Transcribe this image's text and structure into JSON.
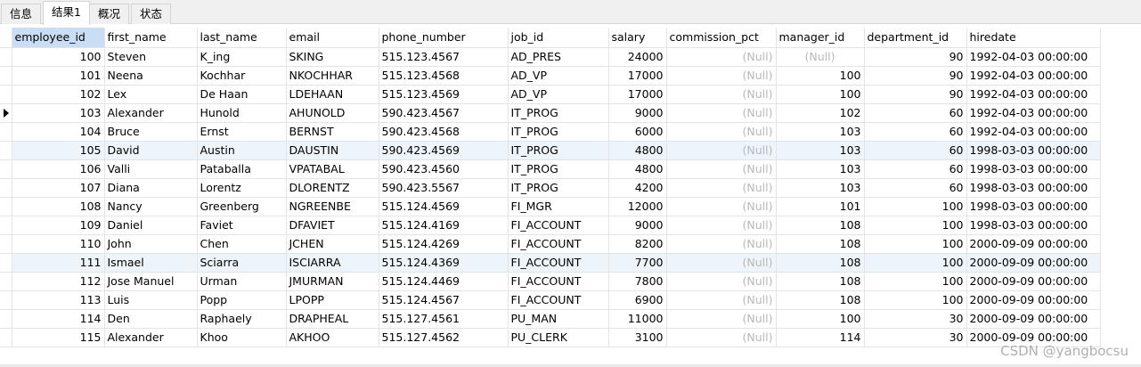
{
  "tabs": [
    {
      "label": "信息",
      "active": false
    },
    {
      "label": "结果1",
      "active": true
    },
    {
      "label": "概况",
      "active": false
    },
    {
      "label": "状态",
      "active": false
    }
  ],
  "columns": [
    "employee_id",
    "first_name",
    "last_name",
    "email",
    "phone_number",
    "job_id",
    "salary",
    "commission_pct",
    "manager_id",
    "department_id",
    "hiredate"
  ],
  "selected_column": "employee_id",
  "current_row_index": 3,
  "null_label": "(Null)",
  "rows": [
    [
      "100",
      "Steven",
      "K_ing",
      "SKING",
      "515.123.4567",
      "AD_PRES",
      "24000",
      null,
      null,
      "90",
      "1992-04-03 00:00:00"
    ],
    [
      "101",
      "Neena",
      "Kochhar",
      "NKOCHHAR",
      "515.123.4568",
      "AD_VP",
      "17000",
      null,
      "100",
      "90",
      "1992-04-03 00:00:00"
    ],
    [
      "102",
      "Lex",
      "De Haan",
      "LDEHAAN",
      "515.123.4569",
      "AD_VP",
      "17000",
      null,
      "100",
      "90",
      "1992-04-03 00:00:00"
    ],
    [
      "103",
      "Alexander",
      "Hunold",
      "AHUNOLD",
      "590.423.4567",
      "IT_PROG",
      "9000",
      null,
      "102",
      "60",
      "1992-04-03 00:00:00"
    ],
    [
      "104",
      "Bruce",
      "Ernst",
      "BERNST",
      "590.423.4568",
      "IT_PROG",
      "6000",
      null,
      "103",
      "60",
      "1992-04-03 00:00:00"
    ],
    [
      "105",
      "David",
      "Austin",
      "DAUSTIN",
      "590.423.4569",
      "IT_PROG",
      "4800",
      null,
      "103",
      "60",
      "1998-03-03 00:00:00"
    ],
    [
      "106",
      "Valli",
      "Pataballa",
      "VPATABAL",
      "590.423.4560",
      "IT_PROG",
      "4800",
      null,
      "103",
      "60",
      "1998-03-03 00:00:00"
    ],
    [
      "107",
      "Diana",
      "Lorentz",
      "DLORENTZ",
      "590.423.5567",
      "IT_PROG",
      "4200",
      null,
      "103",
      "60",
      "1998-03-03 00:00:00"
    ],
    [
      "108",
      "Nancy",
      "Greenberg",
      "NGREENBE",
      "515.124.4569",
      "FI_MGR",
      "12000",
      null,
      "101",
      "100",
      "1998-03-03 00:00:00"
    ],
    [
      "109",
      "Daniel",
      "Faviet",
      "DFAVIET",
      "515.124.4169",
      "FI_ACCOUNT",
      "9000",
      null,
      "108",
      "100",
      "1998-03-03 00:00:00"
    ],
    [
      "110",
      "John",
      "Chen",
      "JCHEN",
      "515.124.4269",
      "FI_ACCOUNT",
      "8200",
      null,
      "108",
      "100",
      "2000-09-09 00:00:00"
    ],
    [
      "111",
      "Ismael",
      "Sciarra",
      "ISCIARRA",
      "515.124.4369",
      "FI_ACCOUNT",
      "7700",
      null,
      "108",
      "100",
      "2000-09-09 00:00:00"
    ],
    [
      "112",
      "Jose Manuel",
      "Urman",
      "JMURMAN",
      "515.124.4469",
      "FI_ACCOUNT",
      "7800",
      null,
      "108",
      "100",
      "2000-09-09 00:00:00"
    ],
    [
      "113",
      "Luis",
      "Popp",
      "LPOPP",
      "515.124.4567",
      "FI_ACCOUNT",
      "6900",
      null,
      "108",
      "100",
      "2000-09-09 00:00:00"
    ],
    [
      "114",
      "Den",
      "Raphaely",
      "DRAPHEAL",
      "515.127.4561",
      "PU_MAN",
      "11000",
      null,
      "100",
      "30",
      "2000-09-09 00:00:00"
    ],
    [
      "115",
      "Alexander",
      "Khoo",
      "AKHOO",
      "515.127.4562",
      "PU_CLERK",
      "3100",
      null,
      "114",
      "30",
      "2000-09-09 00:00:00"
    ]
  ],
  "watermark": "CSDN @yangbocsu"
}
